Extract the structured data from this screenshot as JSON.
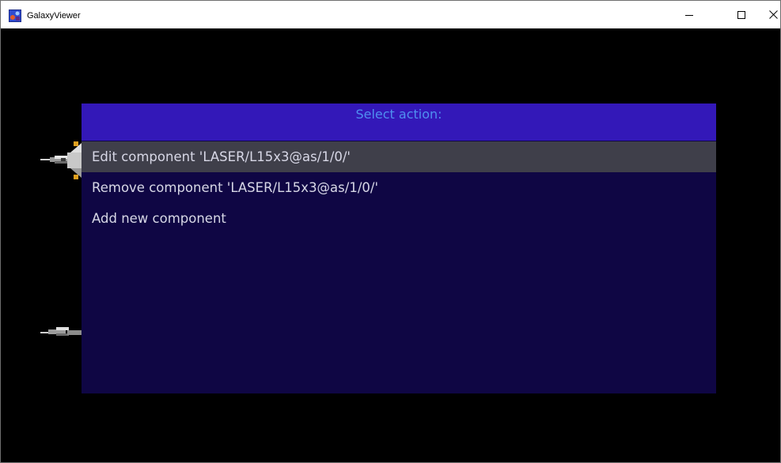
{
  "window": {
    "title": "GalaxyViewer",
    "controls": {
      "minimize": "—",
      "maximize": "☐",
      "close": "✕"
    }
  },
  "dialog": {
    "title": "Select action:",
    "items": [
      {
        "label": "Edit component 'LASER/L15x3@as/1/0/'",
        "selected": true
      },
      {
        "label": "Remove component 'LASER/L15x3@as/1/0/'",
        "selected": false
      },
      {
        "label": "Add new component",
        "selected": false
      }
    ]
  },
  "colors": {
    "background": "#000000",
    "dialog_body": "#0f0644",
    "dialog_header": "#3318b8",
    "dialog_title": "#4f8ff0",
    "selected_row": "#3f3f4a",
    "item_text": "#d7d7e6"
  },
  "icons": {
    "app": "galaxy-app-icon",
    "ship_top": "spaceship-sprite",
    "ship_bottom": "spaceship-sprite"
  }
}
